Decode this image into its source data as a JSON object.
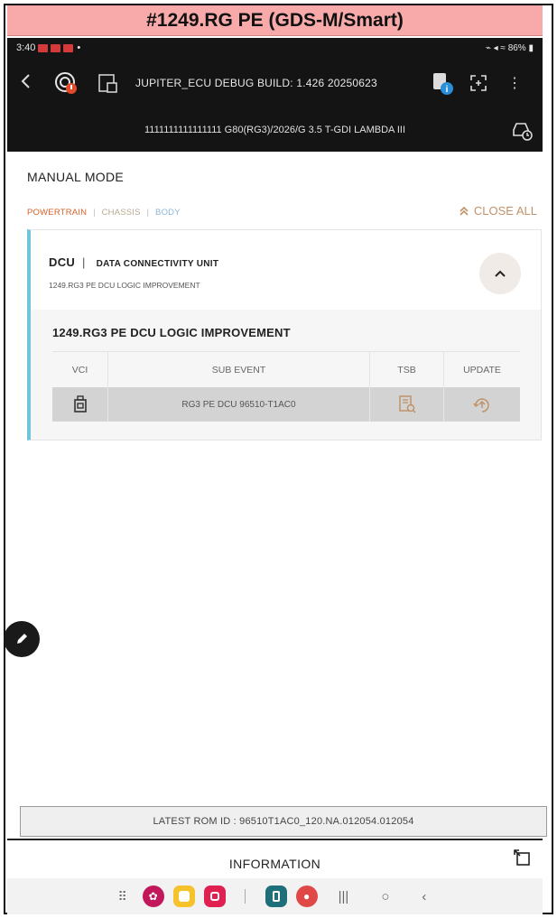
{
  "caption": "#1249.RG PE (GDS-M/Smart)",
  "status_bar": {
    "time": "3:40",
    "battery": "86%"
  },
  "app_bar": {
    "title": "JUPITER_ECU DEBUG BUILD: 1.426 20250623"
  },
  "vehicle_bar": {
    "vin_vehicle": "1111111111111111 G80(RG3)/2026/G 3.5 T-GDI LAMBDA III"
  },
  "manual_mode": {
    "title": "MANUAL MODE",
    "filters": {
      "powertrain": "POWERTRAIN",
      "separator": "|",
      "chassis": "CHASSIS",
      "body": "BODY"
    },
    "close_all": "CLOSE ALL"
  },
  "card": {
    "code": "DCU",
    "separator": "|",
    "name": "DATA CONNECTIVITY UNIT",
    "description": "1249.RG3 PE DCU LOGIC IMPROVEMENT",
    "event_title": "1249.RG3 PE DCU LOGIC IMPROVEMENT",
    "table": {
      "headers": {
        "vci": "VCI",
        "sub_event": "SUB EVENT",
        "tsb": "TSB",
        "update": "UPDATE"
      },
      "rows": [
        {
          "sub_event": "RG3 PE DCU 96510-T1AC0"
        }
      ]
    }
  },
  "rom_bar": {
    "text": "LATEST ROM ID : 96510T1AC0_120.NA.012054.012054"
  },
  "info_bar": {
    "label": "INFORMATION"
  },
  "colors": {
    "accent_orange": "#d9622b",
    "card_stripe": "#6ec3dd",
    "close_all": "#c0926a"
  }
}
